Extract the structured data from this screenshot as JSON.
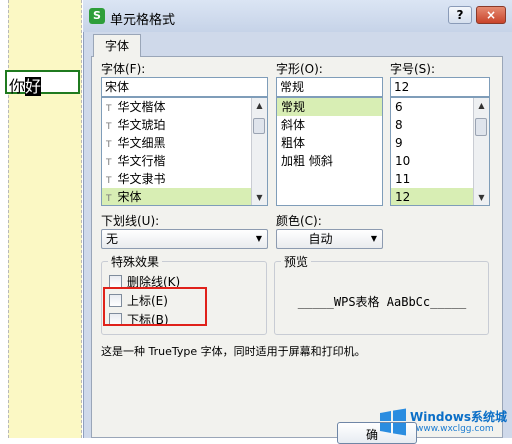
{
  "sheet": {
    "cell_text_plain": "你",
    "cell_text_selected": "好"
  },
  "window": {
    "title": "单元格格式",
    "app_icon": "S",
    "help": "?",
    "close": "×"
  },
  "tabs": [
    {
      "label": "字体"
    }
  ],
  "font": {
    "label": "字体(F):",
    "value": "宋体",
    "items": [
      "华文楷体",
      "华文琥珀",
      "华文细黑",
      "华文行楷",
      "华文隶书",
      "宋体"
    ],
    "selected_index": 5
  },
  "style": {
    "label": "字形(O):",
    "value": "常规",
    "items": [
      "常规",
      "斜体",
      "粗体",
      "加粗 倾斜"
    ],
    "selected_index": 0
  },
  "size": {
    "label": "字号(S):",
    "value": "12",
    "items": [
      "6",
      "8",
      "9",
      "10",
      "11",
      "12"
    ],
    "selected_index": 5
  },
  "underline": {
    "label": "下划线(U):",
    "value": "无"
  },
  "color": {
    "label": "颜色(C):",
    "value": "自动"
  },
  "effects": {
    "title": "特殊效果",
    "strike": "删除线(K)",
    "superscript": "上标(E)",
    "subscript": "下标(B)"
  },
  "preview": {
    "title": "预览",
    "text": "_____WPS表格  AaBbCc_____"
  },
  "note": "这是一种 TrueType 字体，同时适用于屏幕和打印机。",
  "ok_partial": "确",
  "watermark": {
    "title": "Windows系统城",
    "url": "www.wxclgg.com"
  },
  "colors": {
    "accent_green": "#d8eeb4",
    "highlight_red": "#e0211a",
    "sheet_yellow": "#fbf8c4"
  }
}
